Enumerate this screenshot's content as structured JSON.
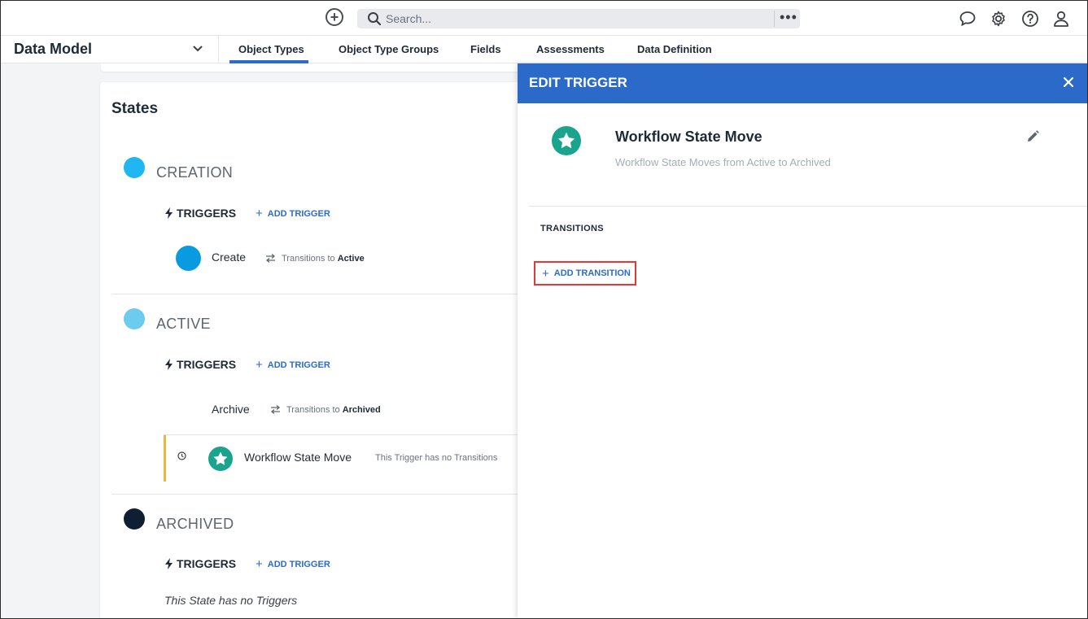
{
  "search": {
    "placeholder": "Search..."
  },
  "topbar": {
    "icons": [
      "add-circle-icon",
      "search-icon",
      "more-icon",
      "chat-icon",
      "gear-icon",
      "help-icon",
      "user-icon"
    ]
  },
  "subnav": {
    "title": "Data Model",
    "tabs": [
      {
        "label": "Object Types",
        "active": true
      },
      {
        "label": "Object Type Groups"
      },
      {
        "label": "Fields"
      },
      {
        "label": "Assessments"
      },
      {
        "label": "Data Definition"
      }
    ]
  },
  "states": {
    "title": "States",
    "triggers_label": "TRIGGERS",
    "add_trigger_label": "ADD TRIGGER",
    "transitions_to_label": "Transitions to",
    "items": [
      {
        "name": "CREATION",
        "color": "#1fb6f2",
        "triggers": [
          {
            "name": "Create",
            "target": "Active",
            "color": "#0a9ae0"
          }
        ]
      },
      {
        "name": "ACTIVE",
        "color": "#6ccbef",
        "triggers": [
          {
            "name": "Archive",
            "target": "Archived"
          },
          {
            "name": "Workflow State Move",
            "note": "This Trigger has no Transitions",
            "color": "#1aa38d"
          }
        ]
      },
      {
        "name": "ARCHIVED",
        "color": "#0e1f33",
        "empty_text": "This State has no Triggers"
      }
    ]
  },
  "panel": {
    "title": "EDIT TRIGGER",
    "trigger_name": "Workflow State Move",
    "trigger_description": "Workflow State Moves from Active to Archived",
    "transitions_label": "TRANSITIONS",
    "add_transition_label": "ADD TRANSITION",
    "header_color": "#2b6ac9",
    "highlight_color": "#e53935"
  }
}
